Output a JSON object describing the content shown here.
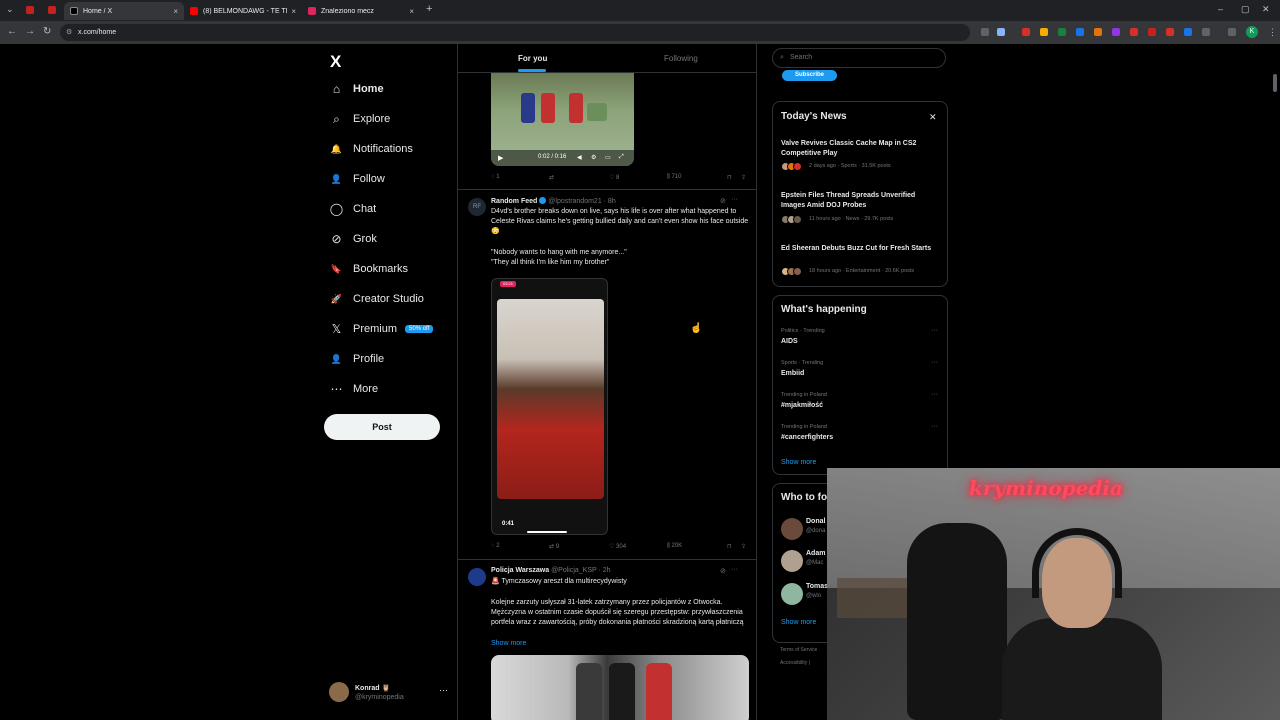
{
  "browser": {
    "tabs": [
      {
        "title": "Home / X",
        "close": "×"
      },
      {
        "title": "(8) BELMONDAWG - TE TE",
        "close": "×"
      },
      {
        "title": "Znaleziono mecz",
        "close": "×"
      }
    ],
    "new_tab": "+",
    "url": "x.com/home",
    "profile_initial": "K"
  },
  "sidebar": {
    "logo": "X",
    "items": [
      {
        "label": "Home",
        "icon": "home-icon",
        "glyph": "⌂"
      },
      {
        "label": "Explore",
        "icon": "search-icon",
        "glyph": "⌕"
      },
      {
        "label": "Notifications",
        "icon": "bell-icon",
        "glyph": "🔔"
      },
      {
        "label": "Follow",
        "icon": "follow-icon",
        "glyph": "👤"
      },
      {
        "label": "Chat",
        "icon": "chat-icon",
        "glyph": "◯"
      },
      {
        "label": "Grok",
        "icon": "grok-icon",
        "glyph": "⊘"
      },
      {
        "label": "Bookmarks",
        "icon": "bookmark-icon",
        "glyph": "🔖"
      },
      {
        "label": "Creator Studio",
        "icon": "rocket-icon",
        "glyph": "🚀"
      },
      {
        "label": "Premium",
        "icon": "x-icon",
        "glyph": "𝕏",
        "badge": "50% off"
      },
      {
        "label": "Profile",
        "icon": "profile-icon",
        "glyph": "👤"
      },
      {
        "label": "More",
        "icon": "more-icon",
        "glyph": "⋯"
      }
    ],
    "post_label": "Post",
    "account": {
      "name": "Konrad 🦉",
      "handle": "@kryminopedia",
      "more": "···"
    }
  },
  "timeline": {
    "tabs": {
      "for_you": "For you",
      "following": "Following"
    },
    "video1": {
      "time": "0:02 / 0:16"
    },
    "actions1": {
      "replies": "1",
      "reposts": "",
      "likes": "8",
      "views": "710"
    },
    "tweet2": {
      "avatar": "RF",
      "name": "Random Feed",
      "handle": "@lpostrandom21 · 8h",
      "text_1": "D4vd's brother breaks down on live, says his life is over after what happened to Celeste Rivas claims he's getting bullied daily and can't even show his face outside 😳",
      "text_2": "\"Nobody wants to hang with me anymore...\"",
      "text_3": "\"They all think I'm like him my brother\"",
      "video_time": "0:41",
      "video_rec": "03:21"
    },
    "actions2": {
      "replies": "2",
      "reposts": "9",
      "likes": "304",
      "views": "20K"
    },
    "tweet3": {
      "name": "Policja Warszawa",
      "handle": "@Policja_KSP · 2h",
      "headline": "🚨 Tymczasowy areszt dla multirecydywisty",
      "body": "Kolejne zarzuty usłyszał 31-latek zatrzymany przez policjantów z Otwocka. Mężczyzna w ostatnim czasie dopuścił się szeregu przestępstw: przywłaszczenia portfela wraz z zawartością, próby dokonania płatności skradzioną kartą płatniczą",
      "show_more": "Show more"
    }
  },
  "right": {
    "search_placeholder": "Search",
    "subscribe": "Subscribe",
    "news": {
      "title": "Today's News",
      "items": [
        {
          "headline": "Valve Revives Classic Cache Map in CS2 Competitive Play",
          "meta": "2 days ago · Sports · 31.5K posts"
        },
        {
          "headline": "Epstein Files Thread Spreads Unverified Images Amid DOJ Probes",
          "meta": "11 hours ago · News · 29.7K posts"
        },
        {
          "headline": "Ed Sheeran Debuts Buzz Cut for Fresh Starts",
          "meta": "18 hours ago · Entertainment · 20.6K posts"
        }
      ]
    },
    "happening": {
      "title": "What's happening",
      "items": [
        {
          "context": "Politics · Trending",
          "name": "AIDS"
        },
        {
          "context": "Sports · Trending",
          "name": "Embiid"
        },
        {
          "context": "Trending in Poland",
          "name": "#mjakmiłość"
        },
        {
          "context": "Trending in Poland",
          "name": "#cancerfighters"
        }
      ],
      "show_more": "Show more"
    },
    "who": {
      "title": "Who to fo",
      "items": [
        {
          "name": "Donal",
          "handle": "@dona"
        },
        {
          "name": "Adam",
          "handle": "@Mac"
        },
        {
          "name": "Tomas",
          "handle": "@wlo"
        }
      ],
      "show_more": "Show more"
    },
    "footer": {
      "line1": "Terms of Service",
      "line2": "Accessibility  |"
    }
  },
  "webcam": {
    "neon": "kryminopedia"
  }
}
